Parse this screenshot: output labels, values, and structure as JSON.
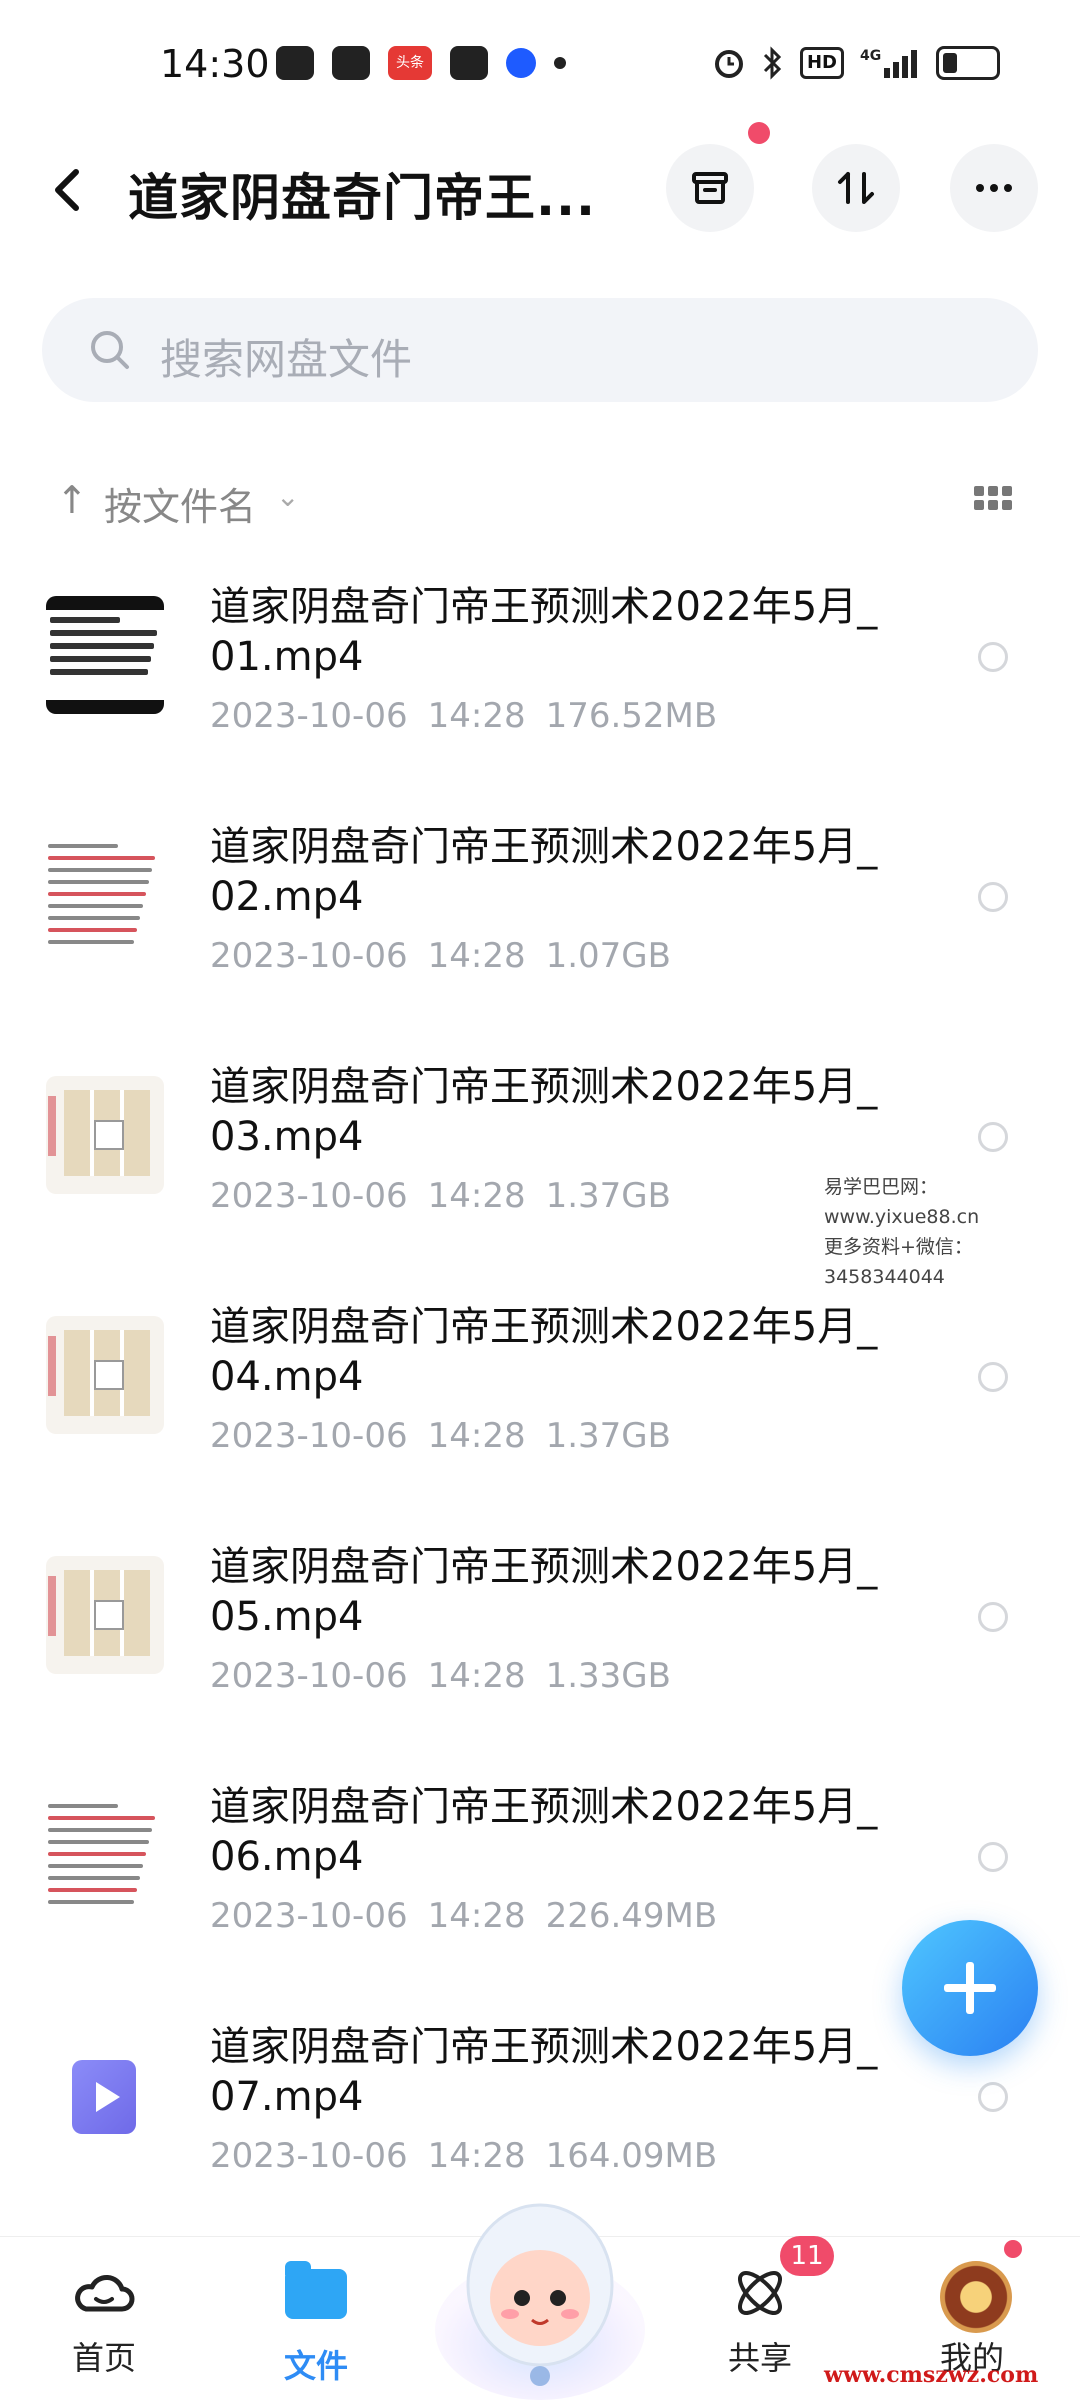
{
  "status_bar": {
    "time": "14:30",
    "app_icons": [
      "wechat-icon",
      "cloud-icon",
      "toutiao-icon",
      "capcut-icon",
      "browser-icon"
    ],
    "toutiao_label": "头条",
    "network": "4G",
    "hd": "HD"
  },
  "header": {
    "title": "道家阴盘奇门帝王..."
  },
  "search": {
    "placeholder": "搜索网盘文件"
  },
  "sort": {
    "arrow": "↑",
    "label": "按文件名",
    "chevron": "⌄"
  },
  "files": [
    {
      "name": "道家阴盘奇门帝王预测术2022年5月_01.mp4",
      "date": "2023-10-06",
      "time": "14:28",
      "size": "176.52MB",
      "thumb": "dark"
    },
    {
      "name": "道家阴盘奇门帝王预测术2022年5月_02.mp4",
      "date": "2023-10-06",
      "time": "14:28",
      "size": "1.07GB",
      "thumb": "text"
    },
    {
      "name": "道家阴盘奇门帝王预测术2022年5月_03.mp4",
      "date": "2023-10-06",
      "time": "14:28",
      "size": "1.37GB",
      "thumb": "board"
    },
    {
      "name": "道家阴盘奇门帝王预测术2022年5月_04.mp4",
      "date": "2023-10-06",
      "time": "14:28",
      "size": "1.37GB",
      "thumb": "board"
    },
    {
      "name": "道家阴盘奇门帝王预测术2022年5月_05.mp4",
      "date": "2023-10-06",
      "time": "14:28",
      "size": "1.33GB",
      "thumb": "board"
    },
    {
      "name": "道家阴盘奇门帝王预测术2022年5月_06.mp4",
      "date": "2023-10-06",
      "time": "14:28",
      "size": "226.49MB",
      "thumb": "text"
    },
    {
      "name": "道家阴盘奇门帝王预测术2022年5月_07.mp4",
      "date": "2023-10-06",
      "time": "14:28",
      "size": "164.09MB",
      "thumb": "video"
    }
  ],
  "watermark": {
    "line1": "易学巴巴网：www.yixue88.cn",
    "line2": "更多资料+微信：3458344044"
  },
  "bottom_nav": {
    "home": "首页",
    "files": "文件",
    "share": "共享",
    "share_badge": "11",
    "mine": "我的"
  },
  "corner_watermark": "www.cmszwz.com",
  "colors": {
    "accent": "#2e8cf5",
    "badge": "#f04b6a",
    "meta_text": "#a3a7ae"
  }
}
